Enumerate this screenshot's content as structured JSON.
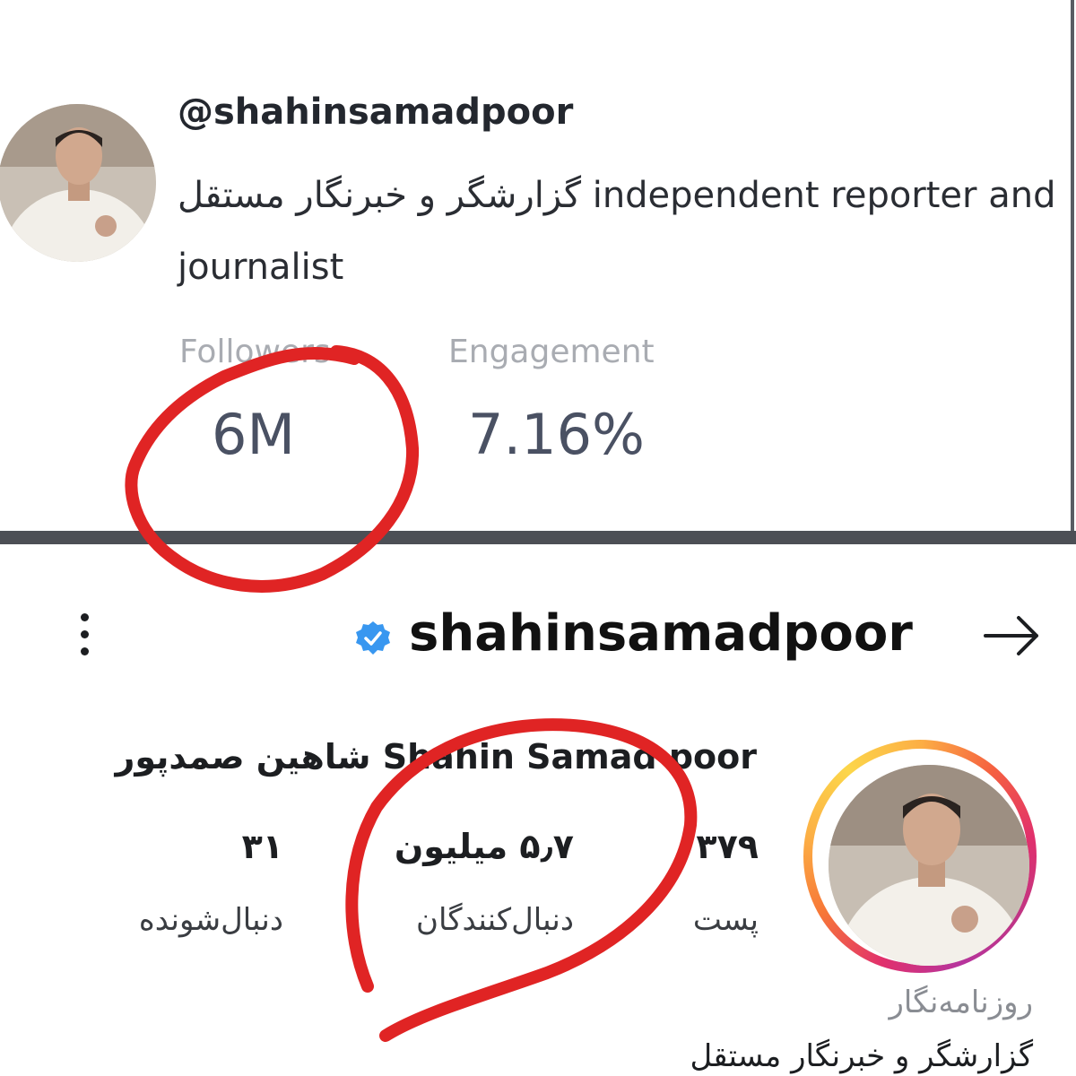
{
  "top_card": {
    "handle": "@shahinsamadpoor",
    "bio": "گزارشگر و خبرنگار مستقل independent reporter and journalist",
    "stats": [
      {
        "label": "Followers",
        "value": "6M"
      },
      {
        "label": "Engagement",
        "value": "7.16%"
      }
    ]
  },
  "instagram": {
    "handle": "shahinsamadpoor",
    "full_name": "شاهین صمدپور Shahin Samad poor",
    "stats": [
      {
        "count": "۳۷۹",
        "label": "پست"
      },
      {
        "count": "۵٫۷ میلیون",
        "label": "دنبال‌کنندگان"
      },
      {
        "count": "۳۱",
        "label": "دنبال‌شونده"
      }
    ],
    "category": "روزنامه‌نگار",
    "bio_line": "گزارشگر و خبرنگار مستقل"
  },
  "colors": {
    "annotation_red": "#e02424",
    "verified_blue": "#3897f0",
    "divider": "#4c4f55"
  },
  "icons": {
    "menu": "kebab-vertical-icon",
    "verified": "verified-badge-icon",
    "back": "arrow-right-icon"
  }
}
